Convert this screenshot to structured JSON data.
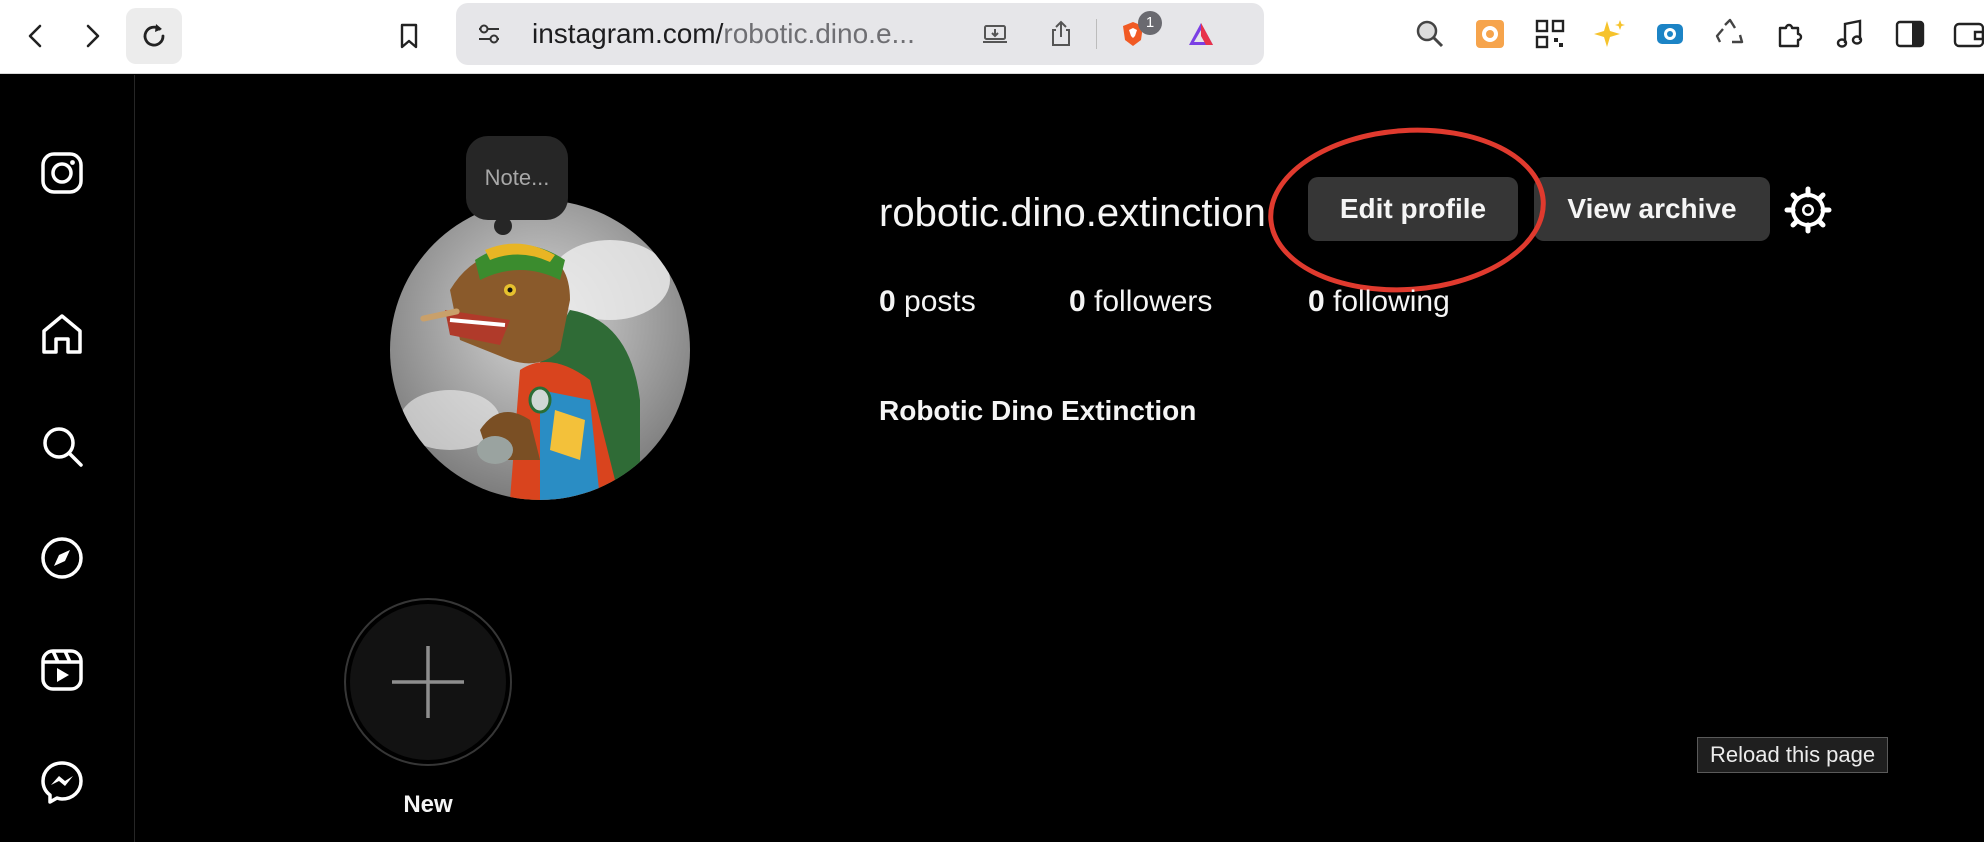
{
  "browser": {
    "url_host": "instagram.com/",
    "url_path": "robotic.dino.e...",
    "brave_badge_count": "1"
  },
  "profile": {
    "note_text": "Note...",
    "username": "robotic.dino.extinction",
    "edit_profile_label": "Edit profile",
    "view_archive_label": "View archive",
    "stats": {
      "posts_count": "0",
      "posts_label": "posts",
      "followers_count": "0",
      "followers_label": "followers",
      "following_count": "0",
      "following_label": "following"
    },
    "full_name": "Robotic Dino Extinction",
    "new_highlight_label": "New"
  },
  "tooltip": {
    "text": "Reload this page"
  },
  "colors": {
    "annotation_circle": "#e03a2e",
    "button_bg": "#363636",
    "background": "#000000"
  },
  "icons": [
    "back-icon",
    "forward-icon",
    "reload-icon",
    "bookmark-icon",
    "site-settings-icon",
    "install-app-icon",
    "share-icon",
    "brave-shields-icon",
    "brave-rewards-icon",
    "zoom-icon",
    "extension-icon",
    "qr-code-icon",
    "sparkles-icon",
    "camera-ext-icon",
    "recycle-icon",
    "extensions-puzzle-icon",
    "music-icon",
    "sidebar-icon",
    "wallet-icon",
    "instagram-logo-icon",
    "home-icon",
    "search-icon",
    "explore-icon",
    "reels-icon",
    "messenger-icon",
    "gear-icon",
    "plus-icon"
  ]
}
